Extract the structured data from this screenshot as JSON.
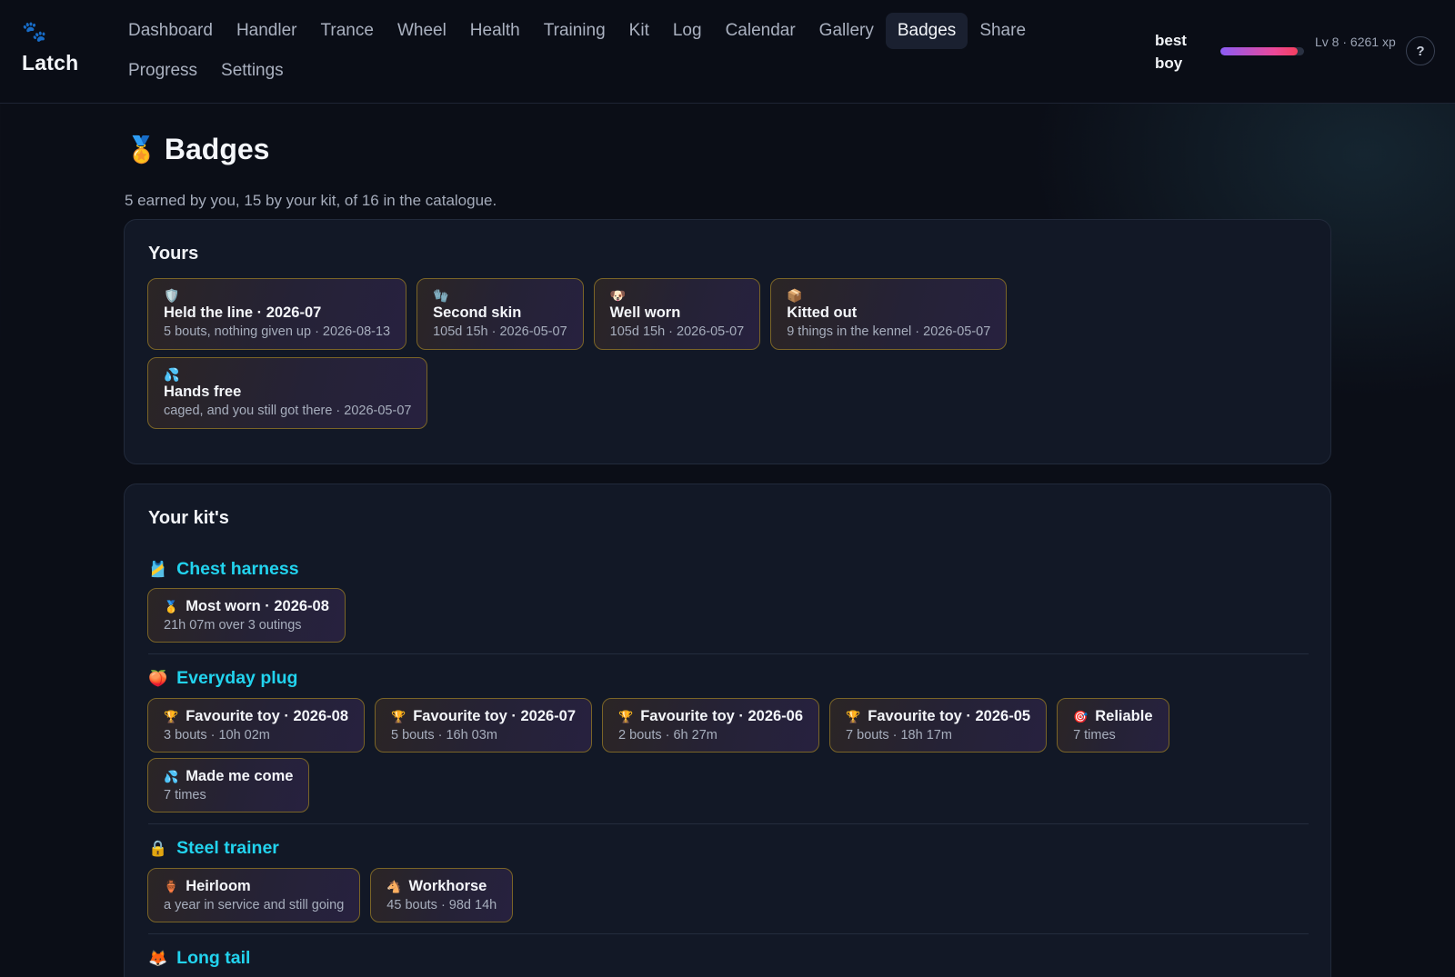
{
  "app": {
    "name": "Latch",
    "paw_icon": "🐾"
  },
  "nav": {
    "items": [
      "Dashboard",
      "Handler",
      "Trance",
      "Wheel",
      "Health",
      "Training",
      "Kit",
      "Log",
      "Calendar",
      "Gallery",
      "Badges",
      "Share",
      "Progress",
      "Settings"
    ],
    "active": "Badges"
  },
  "user": {
    "name": "best boy",
    "level_text": "Lv 8 · 6261 xp",
    "xp_progress_percent": 92
  },
  "help_label": "?",
  "page": {
    "icon": "🏅",
    "title": "Badges",
    "subtitle": "5 earned by you, 15 by your kit, of 16 in the catalogue."
  },
  "yours": {
    "heading": "Yours",
    "badges": [
      {
        "icon": "🛡️",
        "title": "Held the line · 2026-07",
        "desc": "5 bouts, nothing given up · 2026-08-13"
      },
      {
        "icon": "🧤",
        "title": "Second skin",
        "desc": "105d 15h · 2026-05-07"
      },
      {
        "icon": "🐶",
        "title": "Well worn",
        "desc": "105d 15h · 2026-05-07"
      },
      {
        "icon": "📦",
        "title": "Kitted out",
        "desc": "9 things in the kennel · 2026-05-07"
      },
      {
        "icon": "💦",
        "title": "Hands free",
        "desc": "caged, and you still got there · 2026-05-07"
      }
    ]
  },
  "kit": {
    "heading": "Your kit's",
    "sections": [
      {
        "icon": "🎽",
        "name": "Chest harness",
        "badges": [
          {
            "icon": "🥇",
            "title": "Most worn · 2026-08",
            "desc": "21h 07m over 3 outings"
          }
        ]
      },
      {
        "icon": "🍑",
        "name": "Everyday plug",
        "badges": [
          {
            "icon": "🏆",
            "title": "Favourite toy · 2026-08",
            "desc": "3 bouts · 10h 02m"
          },
          {
            "icon": "🏆",
            "title": "Favourite toy · 2026-07",
            "desc": "5 bouts · 16h 03m"
          },
          {
            "icon": "🏆",
            "title": "Favourite toy · 2026-06",
            "desc": "2 bouts · 6h 27m"
          },
          {
            "icon": "🏆",
            "title": "Favourite toy · 2026-05",
            "desc": "7 bouts · 18h 17m"
          },
          {
            "icon": "🎯",
            "title": "Reliable",
            "desc": "7 times"
          },
          {
            "icon": "💦",
            "title": "Made me come",
            "desc": "7 times"
          }
        ]
      },
      {
        "icon": "🔒",
        "name": "Steel trainer",
        "badges": [
          {
            "icon": "🏺",
            "title": "Heirloom",
            "desc": "a year in service and still going"
          },
          {
            "icon": "🐴",
            "title": "Workhorse",
            "desc": "45 bouts · 98d 14h"
          }
        ]
      },
      {
        "icon": "🦊",
        "name": "Long tail",
        "badges": []
      }
    ]
  }
}
